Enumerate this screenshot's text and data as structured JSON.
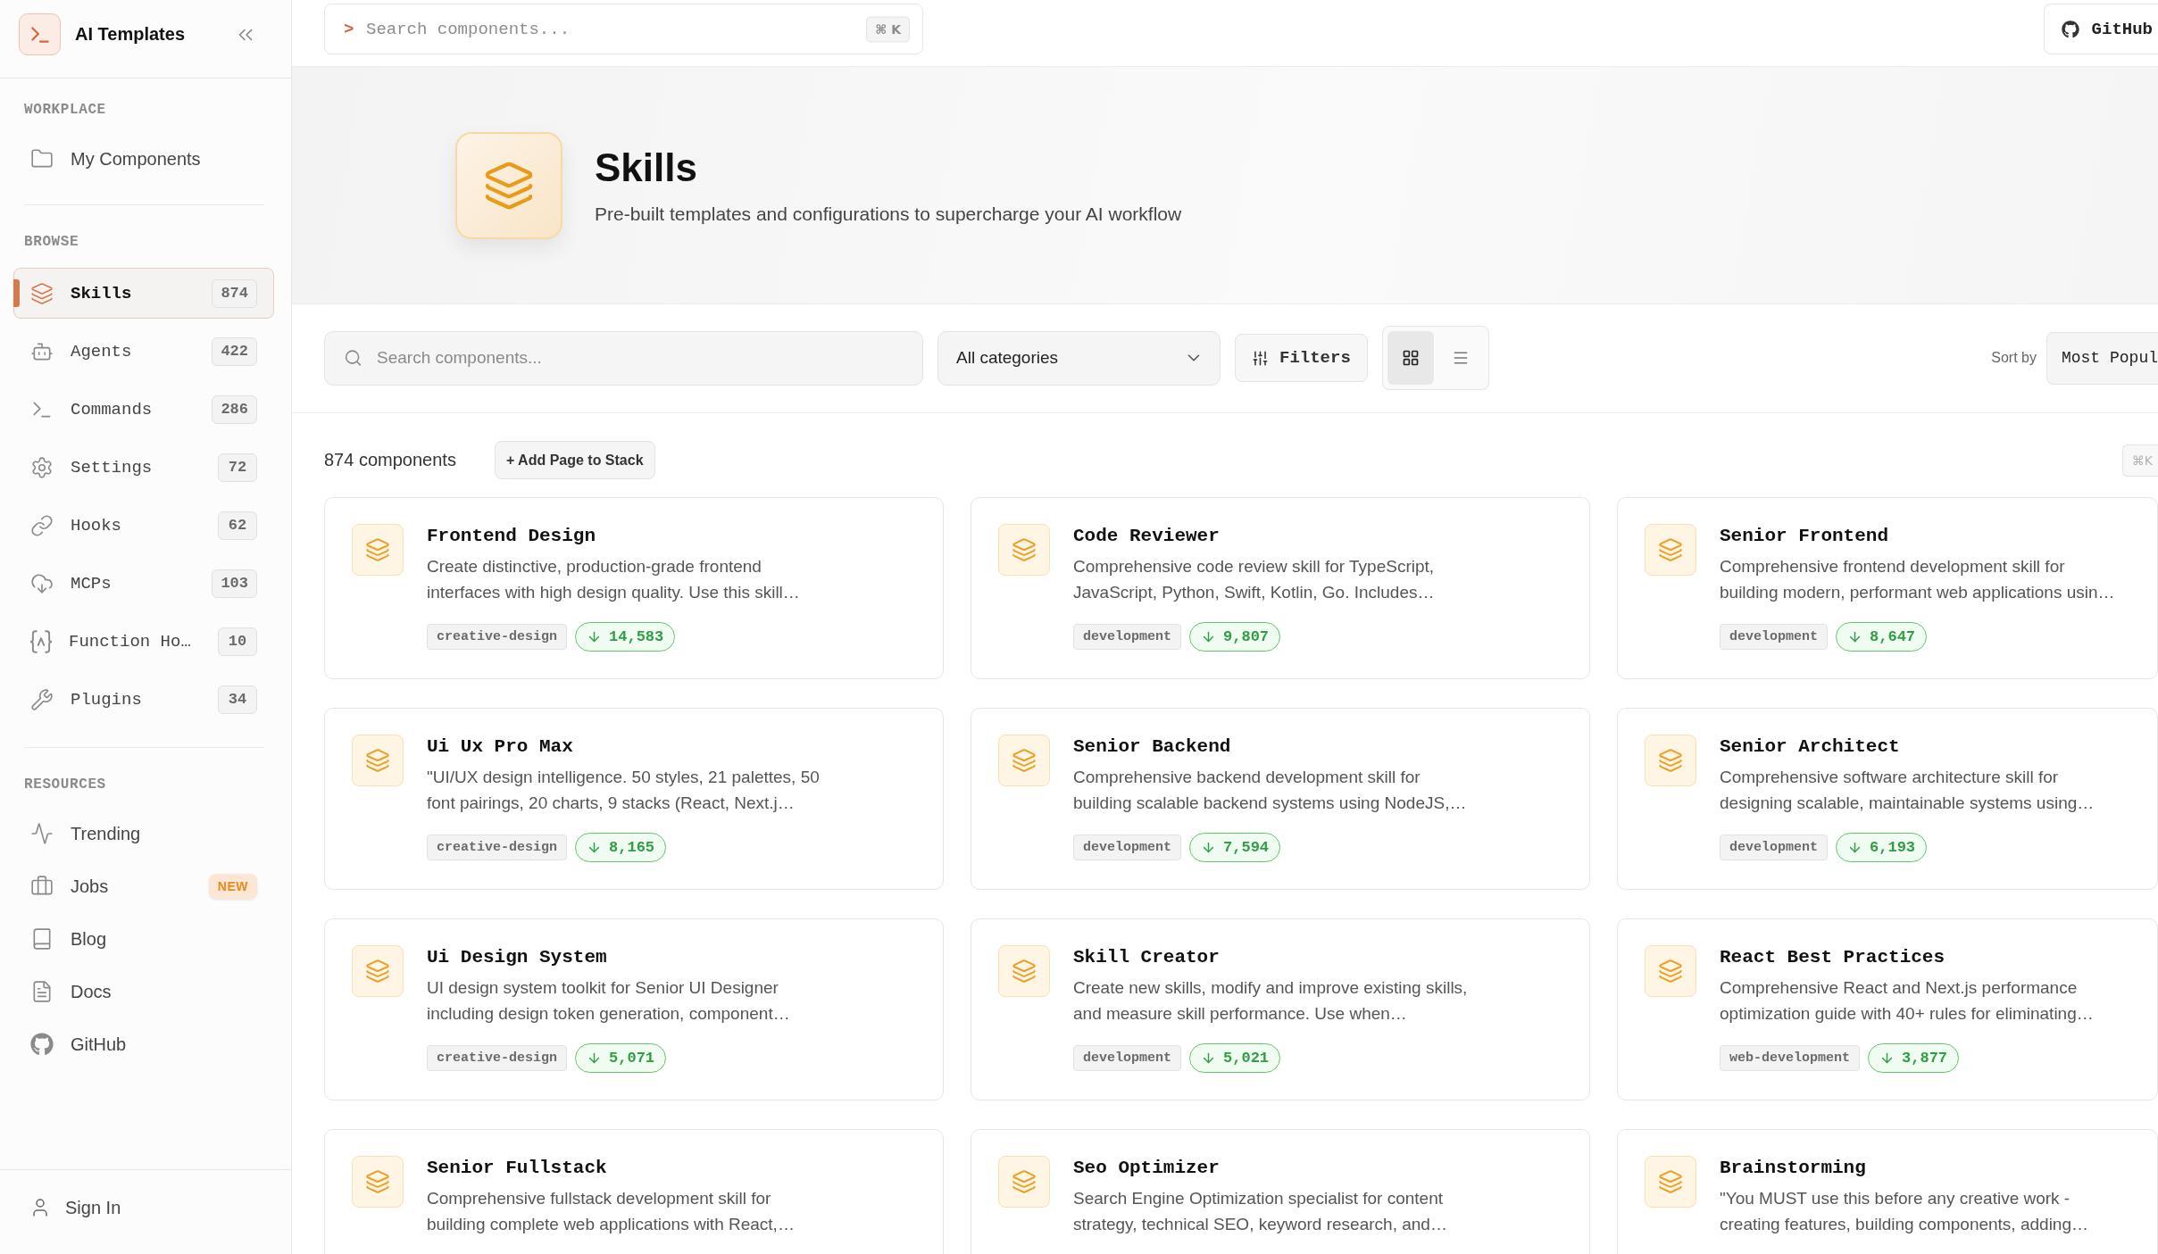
{
  "sidebar": {
    "brand": {
      "title": "AI Templates"
    },
    "sections": [
      {
        "heading": "WORKPLACE",
        "items": [
          {
            "label": "My Components",
            "selected": false
          }
        ]
      },
      {
        "heading": "BROWSE",
        "items": [
          {
            "label": "Skills",
            "count": "874",
            "selected": true
          },
          {
            "label": "Agents",
            "count": "422",
            "selected": false
          },
          {
            "label": "Commands",
            "count": "286",
            "selected": false
          },
          {
            "label": "Settings",
            "count": "72",
            "selected": false
          },
          {
            "label": "Hooks",
            "count": "62",
            "selected": false
          },
          {
            "label": "MCPs",
            "count": "103",
            "selected": false
          },
          {
            "label": "Function Ho…",
            "count": "10",
            "selected": false
          },
          {
            "label": "Plugins",
            "count": "34",
            "selected": false
          }
        ]
      },
      {
        "heading": "RESOURCES",
        "items": [
          {
            "label": "Trending",
            "selected": false
          },
          {
            "label": "Jobs",
            "badge": "NEW",
            "selected": false
          },
          {
            "label": "Blog",
            "selected": false
          },
          {
            "label": "Docs",
            "selected": false
          },
          {
            "label": "GitHub",
            "selected": false
          }
        ]
      }
    ],
    "footer": {
      "label": "Sign In"
    }
  },
  "topbar": {
    "search": {
      "prompt": ">",
      "placeholder": "Search components...",
      "shortcut": "⌘ K"
    },
    "github_button": "GitHub"
  },
  "hero": {
    "title": "Skills",
    "subtitle": "Pre-built templates and configurations to supercharge your AI workflow"
  },
  "toolbar": {
    "search": {
      "placeholder": "Search components..."
    },
    "category_select": "All categories",
    "filters_button": "Filters",
    "view_toggle": [
      {
        "selected": true
      },
      {
        "selected": false
      }
    ],
    "sort_label": "Sort by",
    "sort_select": "Most Popul"
  },
  "results": {
    "count": "874 components",
    "add_button": "+ Add Page to Stack",
    "shortcut": "⌘K"
  },
  "cards": [
    {
      "title": "Frontend Design",
      "description": "Create distinctive, production-grade frontend interfaces with high design quality. Use this skill…",
      "tag": "creative-design",
      "downloads": "14,583"
    },
    {
      "title": "Code Reviewer",
      "description": "Comprehensive code review skill for TypeScript, JavaScript, Python, Swift, Kotlin, Go. Includes…",
      "tag": "development",
      "downloads": "9,807"
    },
    {
      "title": "Senior Frontend",
      "description": "Comprehensive frontend development skill for building modern, performant web applications usin…",
      "tag": "development",
      "downloads": "8,647"
    },
    {
      "title": "Ui Ux Pro Max",
      "description": "\"UI/UX design intelligence. 50 styles, 21 palettes, 50 font pairings, 20 charts, 9 stacks (React, Next.j…",
      "tag": "creative-design",
      "downloads": "8,165"
    },
    {
      "title": "Senior Backend",
      "description": "Comprehensive backend development skill for building scalable backend systems using NodeJS,…",
      "tag": "development",
      "downloads": "7,594"
    },
    {
      "title": "Senior Architect",
      "description": "Comprehensive software architecture skill for designing scalable, maintainable systems using…",
      "tag": "development",
      "downloads": "6,193"
    },
    {
      "title": "Ui Design System",
      "description": "UI design system toolkit for Senior UI Designer including design token generation, component…",
      "tag": "creative-design",
      "downloads": "5,071"
    },
    {
      "title": "Skill Creator",
      "description": "Create new skills, modify and improve existing skills, and measure skill performance. Use when…",
      "tag": "development",
      "downloads": "5,021"
    },
    {
      "title": "React Best Practices",
      "description": "Comprehensive React and Next.js performance optimization guide with 40+ rules for eliminating…",
      "tag": "web-development",
      "downloads": "3,877"
    },
    {
      "title": "Senior Fullstack",
      "description": "Comprehensive fullstack development skill for building complete web applications with React,…"
    },
    {
      "title": "Seo Optimizer",
      "description": "Search Engine Optimization specialist for content strategy, technical SEO, keyword research, and…"
    },
    {
      "title": "Brainstorming",
      "description": "\"You MUST use this before any creative work - creating features, building components, adding…"
    }
  ]
}
